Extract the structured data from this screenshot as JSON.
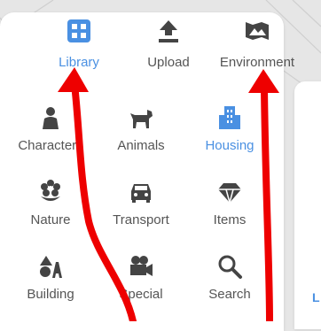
{
  "tabs": [
    {
      "label": "Library",
      "icon": "library-grid-icon",
      "active": true
    },
    {
      "label": "Upload",
      "icon": "upload-icon",
      "active": false
    },
    {
      "label": "Environment",
      "icon": "environment-icon",
      "active": false
    }
  ],
  "categories": [
    {
      "label": "Characters",
      "icon": "person-icon",
      "active": false
    },
    {
      "label": "Animals",
      "icon": "dog-icon",
      "active": false
    },
    {
      "label": "Housing",
      "icon": "buildings-icon",
      "active": true
    },
    {
      "label": "Nature",
      "icon": "flower-icon",
      "active": false
    },
    {
      "label": "Transport",
      "icon": "car-icon",
      "active": false
    },
    {
      "label": "Items",
      "icon": "diamond-icon",
      "active": false
    },
    {
      "label": "Building",
      "icon": "shapes-icon",
      "active": false
    },
    {
      "label": "Special",
      "icon": "camera-icon",
      "active": false
    },
    {
      "label": "Search",
      "icon": "search-icon",
      "active": false
    }
  ],
  "colors": {
    "accent": "#4a90e2",
    "icon": "#444444",
    "arrow": "#ee0000"
  },
  "right_panel": {
    "label_fragment": "L"
  }
}
